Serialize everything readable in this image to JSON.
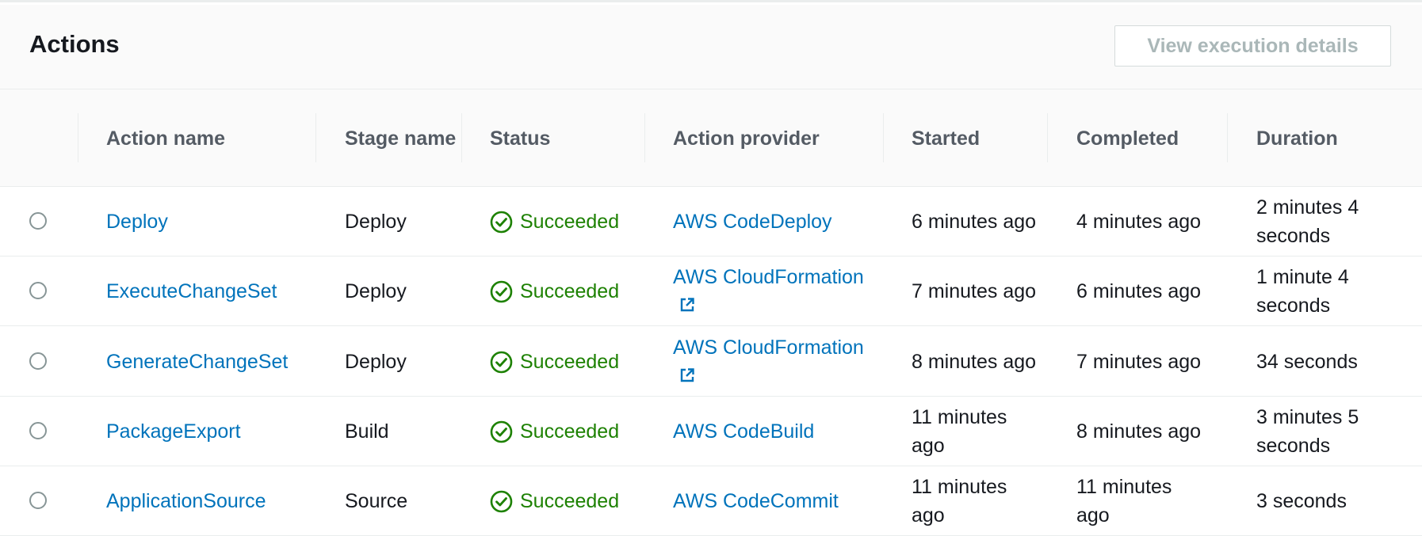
{
  "panel": {
    "title": "Actions",
    "view_details_label": "View execution details"
  },
  "columns": {
    "action_name": "Action name",
    "stage_name": "Stage name",
    "status": "Status",
    "action_provider": "Action provider",
    "started": "Started",
    "completed": "Completed",
    "duration": "Duration"
  },
  "rows": [
    {
      "action_name": "Deploy",
      "stage_name": "Deploy",
      "status": "Succeeded",
      "provider": "AWS CodeDeploy",
      "provider_external": false,
      "started": "6 minutes ago",
      "completed": "4 minutes ago",
      "duration": "2 minutes 4 seconds"
    },
    {
      "action_name": "ExecuteChangeSet",
      "stage_name": "Deploy",
      "status": "Succeeded",
      "provider": "AWS CloudFormation",
      "provider_external": true,
      "started": "7 minutes ago",
      "completed": "6 minutes ago",
      "duration": "1 minute 4 seconds"
    },
    {
      "action_name": "GenerateChangeSet",
      "stage_name": "Deploy",
      "status": "Succeeded",
      "provider": "AWS CloudFormation",
      "provider_external": true,
      "started": "8 minutes ago",
      "completed": "7 minutes ago",
      "duration": "34 seconds"
    },
    {
      "action_name": "PackageExport",
      "stage_name": "Build",
      "status": "Succeeded",
      "provider": "AWS CodeBuild",
      "provider_external": false,
      "started": "11 minutes ago",
      "completed": "8 minutes ago",
      "duration": "3 minutes 5 seconds"
    },
    {
      "action_name": "ApplicationSource",
      "stage_name": "Source",
      "status": "Succeeded",
      "provider": "AWS CodeCommit",
      "provider_external": false,
      "started": "11 minutes ago",
      "completed": "11 minutes ago",
      "duration": "3 seconds"
    }
  ],
  "icons": {
    "status": "check-circle-icon",
    "external": "external-link-icon"
  },
  "colors": {
    "link": "#0073bb",
    "success": "#1d8102",
    "header_text": "#545b64",
    "disabled_text": "#aab7b8"
  }
}
